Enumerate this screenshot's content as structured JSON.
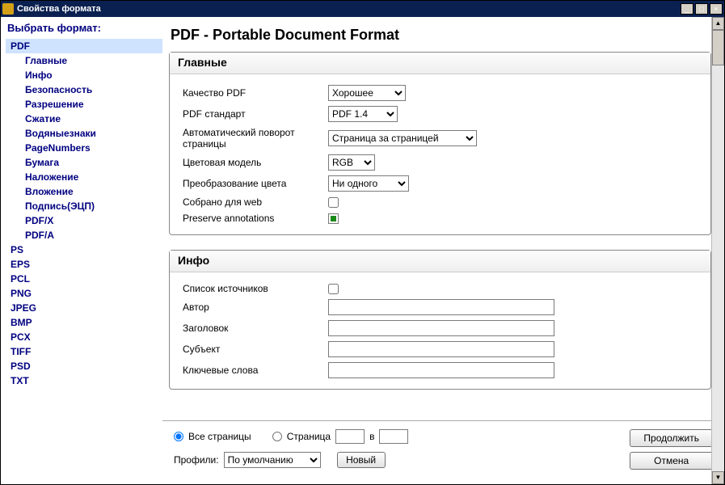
{
  "titlebar": {
    "title": "Свойства формата"
  },
  "sidebar": {
    "title": "Выбрать формат:",
    "pdf": "PDF",
    "pdf_children": [
      "Главные",
      "Инфо",
      "Безопасность",
      "Разрешение",
      "Сжатие",
      "Водяныезнаки",
      "PageNumbers",
      "Бумага",
      "Наложение",
      "Вложение",
      "Подпись(ЭЦП)",
      "PDF/X",
      "PDF/A"
    ],
    "others": [
      "PS",
      "EPS",
      "PCL",
      "PNG",
      "JPEG",
      "BMP",
      "PCX",
      "TIFF",
      "PSD",
      "TXT"
    ]
  },
  "page": {
    "title": "PDF - Portable Document Format",
    "section_main": "Главные",
    "section_info": "Инфо",
    "q_label": "Качество PDF",
    "q_value": "Хорошее",
    "std_label": "PDF стандарт",
    "std_value": "PDF 1.4",
    "rot_label": "Автоматический поворот страницы",
    "rot_value": "Страница за страницей",
    "cm_label": "Цветовая модель",
    "cm_value": "RGB",
    "cc_label": "Преобразование цвета",
    "cc_value": "Ни одного",
    "web_label": "Собрано для web",
    "ann_label": "Preserve annotations",
    "srclist_label": "Список источников",
    "author_label": "Автор",
    "title_label": "Заголовок",
    "subj_label": "Субъект",
    "kw_label": "Ключевые слова"
  },
  "footer": {
    "all_pages": "Все страницы",
    "page_label": "Страница",
    "in_label": "в",
    "profiles_label": "Профили:",
    "profile_value": "По умолчанию",
    "new_btn": "Новый",
    "continue_btn": "Продолжить",
    "cancel_btn": "Отмена"
  }
}
